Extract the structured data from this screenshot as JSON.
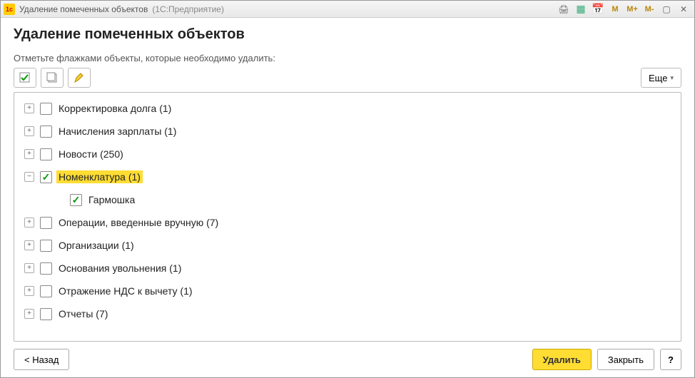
{
  "window": {
    "title": "Удаление помеченных объектов",
    "app": "(1С:Предприятие)"
  },
  "header": {
    "title": "Удаление помеченных объектов",
    "instruction": "Отметьте флажками объекты, которые необходимо удалить:"
  },
  "toolbar": {
    "more_label": "Еще"
  },
  "tree": [
    {
      "label": "Корректировка долга (1)",
      "checked": false,
      "expandable": true,
      "expanded": false,
      "highlight": false,
      "level": 0
    },
    {
      "label": "Начисления зарплаты (1)",
      "checked": false,
      "expandable": true,
      "expanded": false,
      "highlight": false,
      "level": 0
    },
    {
      "label": "Новости (250)",
      "checked": false,
      "expandable": true,
      "expanded": false,
      "highlight": false,
      "level": 0
    },
    {
      "label": "Номенклатура (1)",
      "checked": true,
      "expandable": true,
      "expanded": true,
      "highlight": true,
      "level": 0
    },
    {
      "label": "Гармошка",
      "checked": true,
      "expandable": false,
      "expanded": false,
      "highlight": false,
      "level": 1
    },
    {
      "label": "Операции, введенные вручную (7)",
      "checked": false,
      "expandable": true,
      "expanded": false,
      "highlight": false,
      "level": 0
    },
    {
      "label": "Организации (1)",
      "checked": false,
      "expandable": true,
      "expanded": false,
      "highlight": false,
      "level": 0
    },
    {
      "label": "Основания увольнения (1)",
      "checked": false,
      "expandable": true,
      "expanded": false,
      "highlight": false,
      "level": 0
    },
    {
      "label": "Отражение НДС к вычету (1)",
      "checked": false,
      "expandable": true,
      "expanded": false,
      "highlight": false,
      "level": 0
    },
    {
      "label": "Отчеты (7)",
      "checked": false,
      "expandable": true,
      "expanded": false,
      "highlight": false,
      "level": 0
    }
  ],
  "footer": {
    "back": "< Назад",
    "delete": "Удалить",
    "close": "Закрыть",
    "help": "?"
  }
}
